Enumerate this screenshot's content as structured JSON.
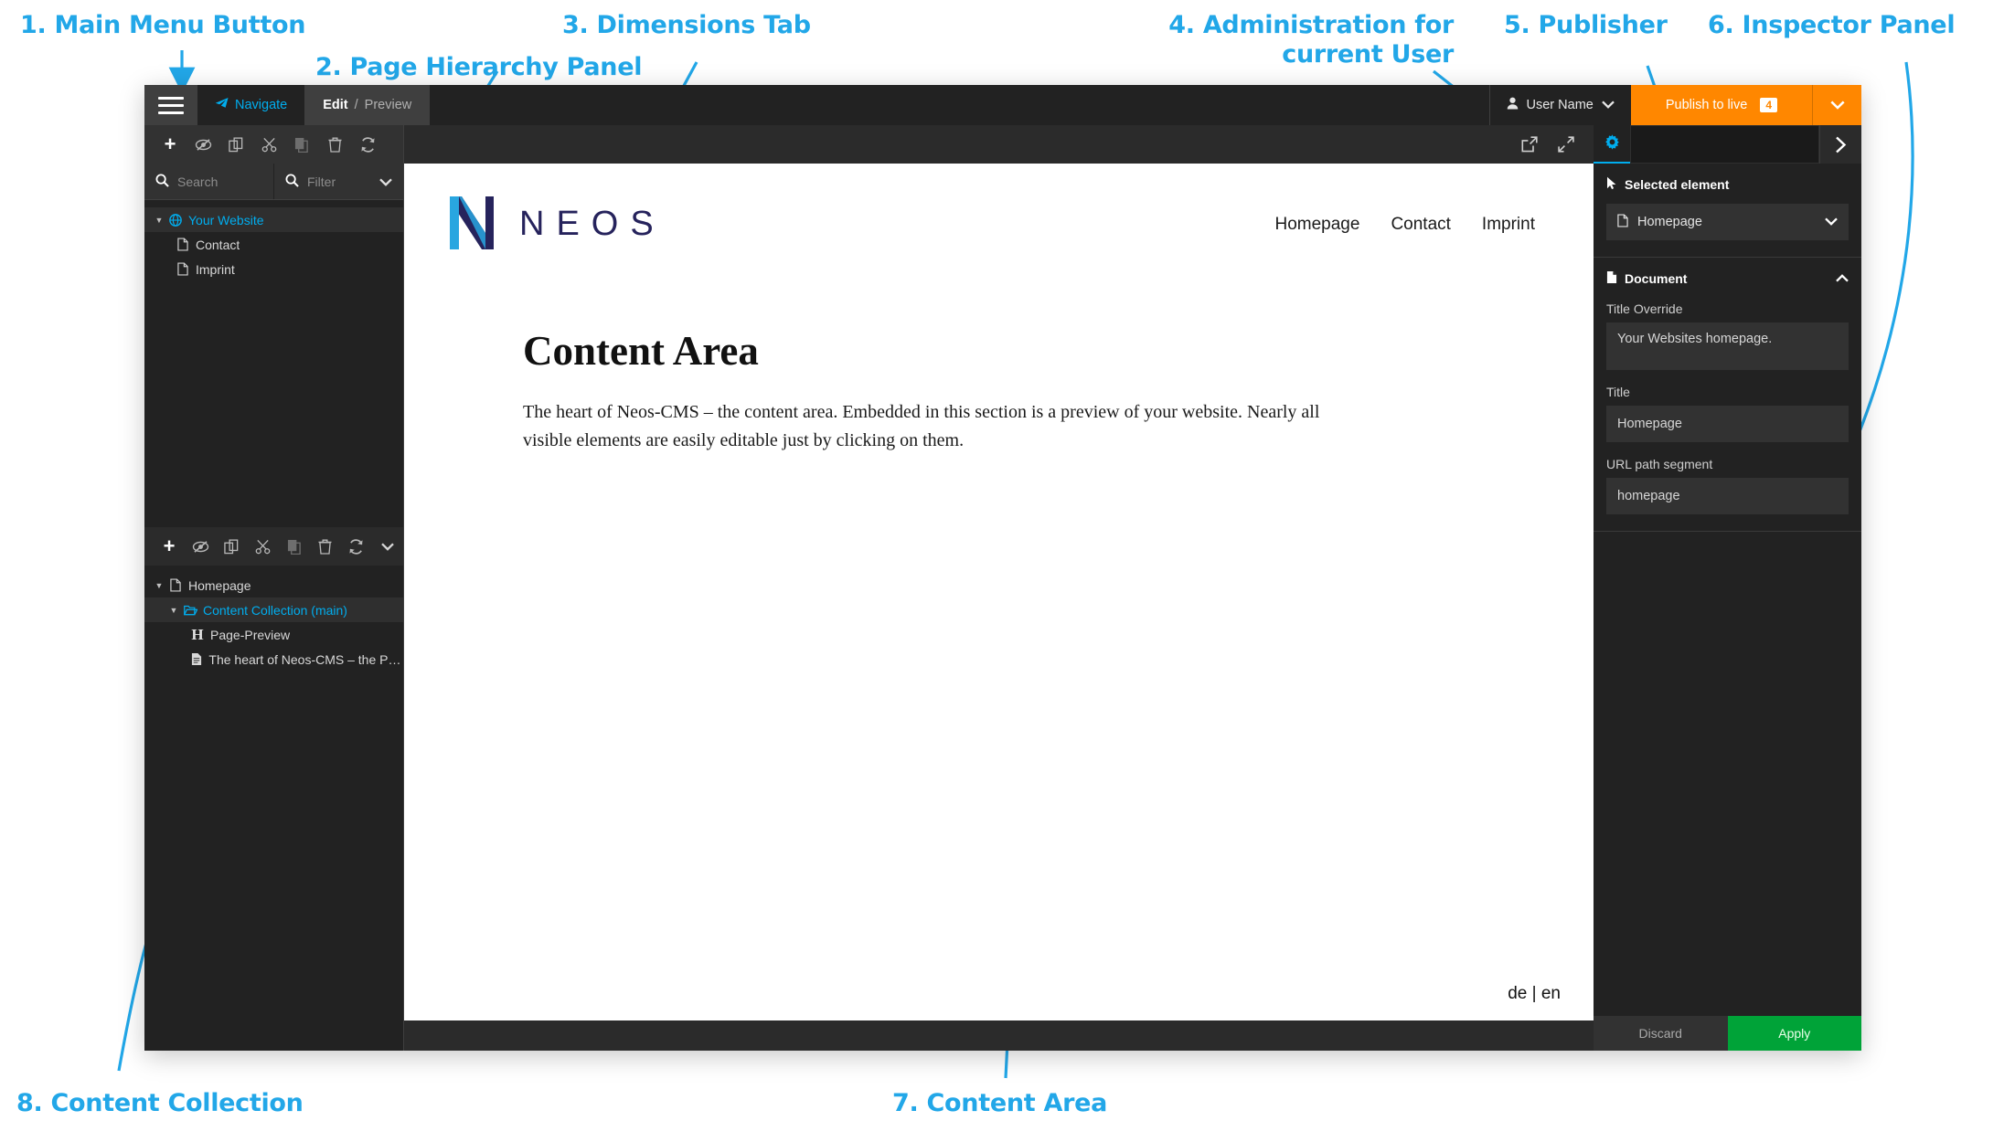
{
  "annotations": [
    {
      "id": 1,
      "text": "1. Main Menu Button"
    },
    {
      "id": 2,
      "text": "2. Page Hierarchy Panel"
    },
    {
      "id": 3,
      "text": "3. Dimensions Tab"
    },
    {
      "id": 4,
      "text": "4. Administration for\ncurrent User"
    },
    {
      "id": 5,
      "text": "5. Publisher"
    },
    {
      "id": 6,
      "text": "6. Inspector Panel"
    },
    {
      "id": 7,
      "text": "7. Content Area"
    },
    {
      "id": 8,
      "text": "8. Content Collection"
    }
  ],
  "colors": {
    "accent": "#00adee",
    "annotation": "#22a7e8",
    "publish": "#ff8700",
    "apply": "#00a338",
    "app_bg": "#222222"
  },
  "topbar": {
    "menu_icon": "hamburger-menu-icon",
    "navigate_label": "Navigate",
    "navigate_icon": "paper-plane-icon",
    "edit_label": "Edit",
    "separator": "/",
    "preview_label": "Preview",
    "user_name": "User Name",
    "user_icon": "user-icon",
    "user_caret": "chevron-down-icon",
    "publish_label": "Publish to live",
    "publish_count": "4",
    "publish_caret": "chevron-down-icon"
  },
  "page_tree": {
    "toolbar": [
      {
        "name": "add",
        "icon": "plus-icon"
      },
      {
        "name": "hide",
        "icon": "eye-slash-icon"
      },
      {
        "name": "paste",
        "icon": "paste-icon"
      },
      {
        "name": "cut",
        "icon": "scissors-icon"
      },
      {
        "name": "copy",
        "icon": "copy-icon"
      },
      {
        "name": "delete",
        "icon": "trash-icon"
      },
      {
        "name": "refresh",
        "icon": "refresh-icon"
      }
    ],
    "search_placeholder": "Search",
    "filter_placeholder": "Filter",
    "nodes": [
      {
        "label": "Your Website",
        "icon": "globe-icon",
        "depth": 0,
        "active": true,
        "expanded": true
      },
      {
        "label": "Contact",
        "icon": "document-icon",
        "depth": 1,
        "active": false,
        "expanded": false
      },
      {
        "label": "Imprint",
        "icon": "document-icon",
        "depth": 1,
        "active": false,
        "expanded": false
      }
    ]
  },
  "content_tree": {
    "toolbar": [
      {
        "name": "add",
        "icon": "plus-icon"
      },
      {
        "name": "hide",
        "icon": "eye-slash-icon"
      },
      {
        "name": "paste",
        "icon": "paste-icon"
      },
      {
        "name": "cut",
        "icon": "scissors-icon"
      },
      {
        "name": "copy",
        "icon": "copy-icon"
      },
      {
        "name": "delete",
        "icon": "trash-icon"
      },
      {
        "name": "refresh",
        "icon": "refresh-icon"
      },
      {
        "name": "more",
        "icon": "chevron-down-icon"
      }
    ],
    "nodes": [
      {
        "label": "Homepage",
        "icon": "document-icon",
        "depth": 0,
        "active": false,
        "expanded": true
      },
      {
        "label": "Content Collection (main)",
        "icon": "folder-open-icon",
        "depth": 1,
        "active": true,
        "expanded": true
      },
      {
        "label": "Page-Preview",
        "icon": "heading-icon",
        "depth": 2,
        "active": false,
        "expanded": false
      },
      {
        "label": "The heart of Neos-CMS – the Page...",
        "icon": "text-document-icon",
        "depth": 2,
        "active": false,
        "expanded": false
      }
    ]
  },
  "preview": {
    "toolbar": [
      {
        "name": "open-in-new-window",
        "icon": "external-link-icon"
      },
      {
        "name": "fullscreen",
        "icon": "expand-icon"
      }
    ],
    "site": {
      "logo_text": "NEOS",
      "logo_icon": "neos-n-logo",
      "nav": [
        "Homepage",
        "Contact",
        "Imprint"
      ],
      "heading": "Content Area",
      "paragraph": "The heart of Neos-CMS – the content area. Embedded in this section is a preview of your website. Nearly all visible elements are easily editable just by clicking on them.",
      "language_switch": "de | en"
    }
  },
  "inspector": {
    "tab_icon": "gear-icon",
    "collapse_icon": "chevron-right-icon",
    "selected_element": {
      "title": "Selected element",
      "title_icon": "cursor-arrow-icon",
      "value": "Homepage",
      "value_icon": "document-icon",
      "caret": "chevron-down-icon"
    },
    "document": {
      "title": "Document",
      "title_icon": "document-icon",
      "collapse_caret": "chevron-up-icon",
      "fields": [
        {
          "label": "Title Override",
          "value": "Your Websites homepage."
        },
        {
          "label": "Title",
          "value": "Homepage"
        },
        {
          "label": "URL path segment",
          "value": "homepage"
        }
      ]
    },
    "footer": {
      "discard_label": "Discard",
      "apply_label": "Apply"
    }
  }
}
